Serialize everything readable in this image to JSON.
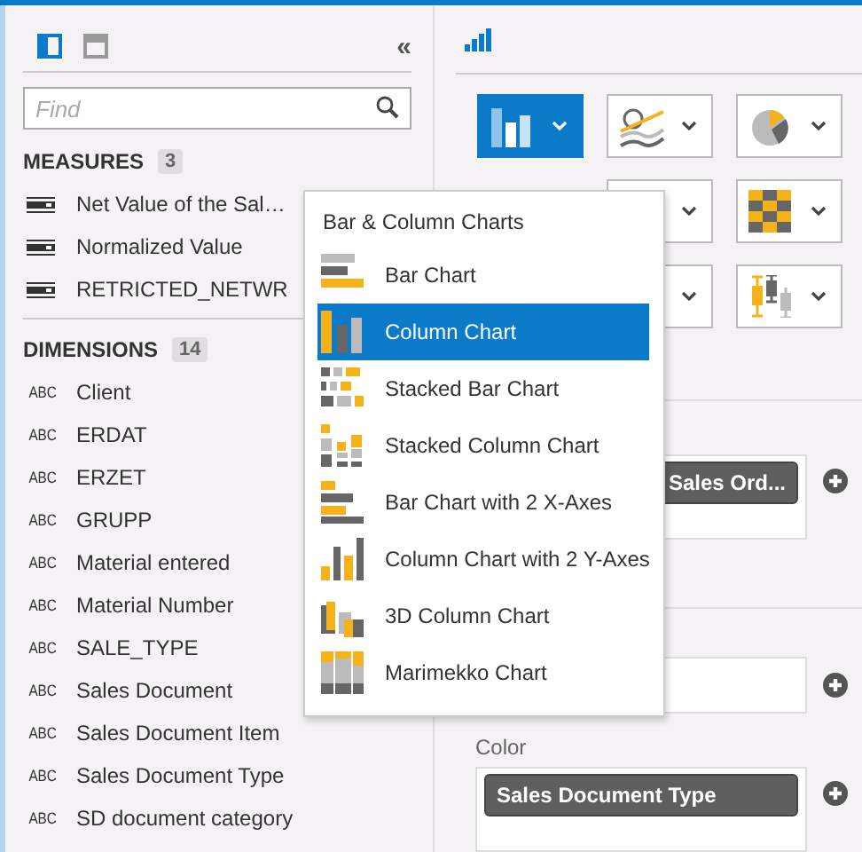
{
  "view_tabs": [
    {
      "kind": "side",
      "selected": true
    },
    {
      "kind": "top",
      "selected": false
    }
  ],
  "collapse": "«",
  "search": {
    "placeholder": "Find"
  },
  "measures": {
    "title": "MEASURES",
    "count": "3",
    "items": [
      "Net Value of the Sal…",
      "Normalized Value",
      "RETRICTED_NETWR"
    ]
  },
  "dimensions": {
    "title": "DIMENSIONS",
    "count": "14",
    "items": [
      {
        "tag": "ABC",
        "name": "Client"
      },
      {
        "tag": "ABC",
        "name": "ERDAT"
      },
      {
        "tag": "ABC",
        "name": "ERZET"
      },
      {
        "tag": "ABC",
        "name": "GRUPP"
      },
      {
        "tag": "ABC",
        "name": "Material entered"
      },
      {
        "tag": "ABC",
        "name": "Material Number"
      },
      {
        "tag": "ABC",
        "name": "SALE_TYPE"
      },
      {
        "tag": "ABC",
        "name": "Sales Document"
      },
      {
        "tag": "ABC",
        "name": "Sales Document Item"
      },
      {
        "tag": "ABC",
        "name": "Sales Document Type"
      },
      {
        "tag": "ABC",
        "name": "SD document category"
      }
    ]
  },
  "chart_type_rows": [
    [
      {
        "kind": "column",
        "selected": true
      },
      {
        "kind": "line",
        "selected": false
      },
      {
        "kind": "pie",
        "selected": false
      }
    ],
    [
      {
        "kind": "plain",
        "selected": false
      },
      {
        "kind": "heatmap",
        "selected": false
      }
    ],
    [
      {
        "kind": "plain",
        "selected": false
      },
      {
        "kind": "boxplot",
        "selected": false
      }
    ]
  ],
  "menu": {
    "title": "Bar & Column Charts",
    "items": [
      {
        "label": "Bar Chart",
        "kind": "bar",
        "selected": false
      },
      {
        "label": "Column Chart",
        "kind": "column",
        "selected": true
      },
      {
        "label": "Stacked Bar Chart",
        "kind": "stackedbar",
        "selected": false
      },
      {
        "label": "Stacked Column Chart",
        "kind": "stackedcolumn",
        "selected": false
      },
      {
        "label": "Bar Chart with 2 X-Axes",
        "kind": "dualbar",
        "selected": false
      },
      {
        "label": "Column Chart with 2 Y-Axes",
        "kind": "dualcolumn",
        "selected": false
      },
      {
        "label": "3D Column Chart",
        "kind": "threed",
        "selected": false
      },
      {
        "label": "Marimekko Chart",
        "kind": "marimekko",
        "selected": false
      }
    ]
  },
  "shelves": [
    {
      "kind": "tall",
      "chips": [
        "Sales Ord..."
      ]
    },
    {
      "kind": "short"
    },
    {
      "kind": "tall",
      "label": "Color",
      "chips": [
        "Sales Document Type"
      ]
    }
  ]
}
